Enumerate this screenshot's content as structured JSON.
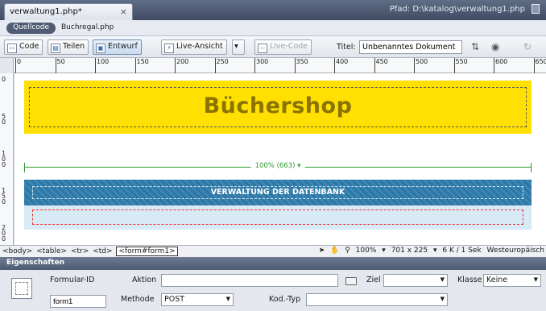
{
  "document_tab": {
    "name": "verwaltung1.php*",
    "close": "×"
  },
  "path": {
    "label": "Pfad:",
    "value": "D:\\katalog\\verwaltung1.php"
  },
  "related": {
    "source": "Quellcode",
    "file": "Buchregal.php"
  },
  "toolbar": {
    "code": "Code",
    "split": "Teilen",
    "design": "Entwurf",
    "live_view": "Live-Ansicht",
    "live_code": "Live-Code",
    "title_label": "Titel:",
    "title_value": "Unbenanntes Dokument"
  },
  "ruler": {
    "labels": [
      "0",
      "50",
      "100",
      "150",
      "200",
      "250",
      "300",
      "350",
      "400",
      "450",
      "500",
      "550",
      "600",
      "650"
    ]
  },
  "vruler": {
    "labels": [
      "0",
      "50",
      "100",
      "150",
      "200"
    ]
  },
  "page": {
    "header_title": "Büchershop",
    "table_width": "100% (663) ▾",
    "banner_text": "VERWALTUNG DER DATENBANK"
  },
  "status": {
    "tags": [
      "<body>",
      "<table>",
      "<tr>",
      "<td>",
      "<form#form1>"
    ],
    "zoom": "100%",
    "size": "701 x 225",
    "download": "6 K / 1 Sek",
    "encoding": "Westeuropäisch"
  },
  "properties": {
    "title": "Eigenschaften",
    "form_id_label": "Formular-ID",
    "form_id_value": "form1",
    "action_label": "Aktion",
    "action_value": "",
    "target_label": "Ziel",
    "target_value": "",
    "class_label": "Klasse",
    "class_value": "Keine",
    "method_label": "Methode",
    "method_value": "POST",
    "enctype_label": "Kod.-Typ",
    "enctype_value": ""
  },
  "colors": {
    "header_bg": "#ffe000",
    "banner_bg": "#2f76a3",
    "form_row_bg": "#d7eaf5",
    "table_indicator": "#2d9a2d"
  }
}
